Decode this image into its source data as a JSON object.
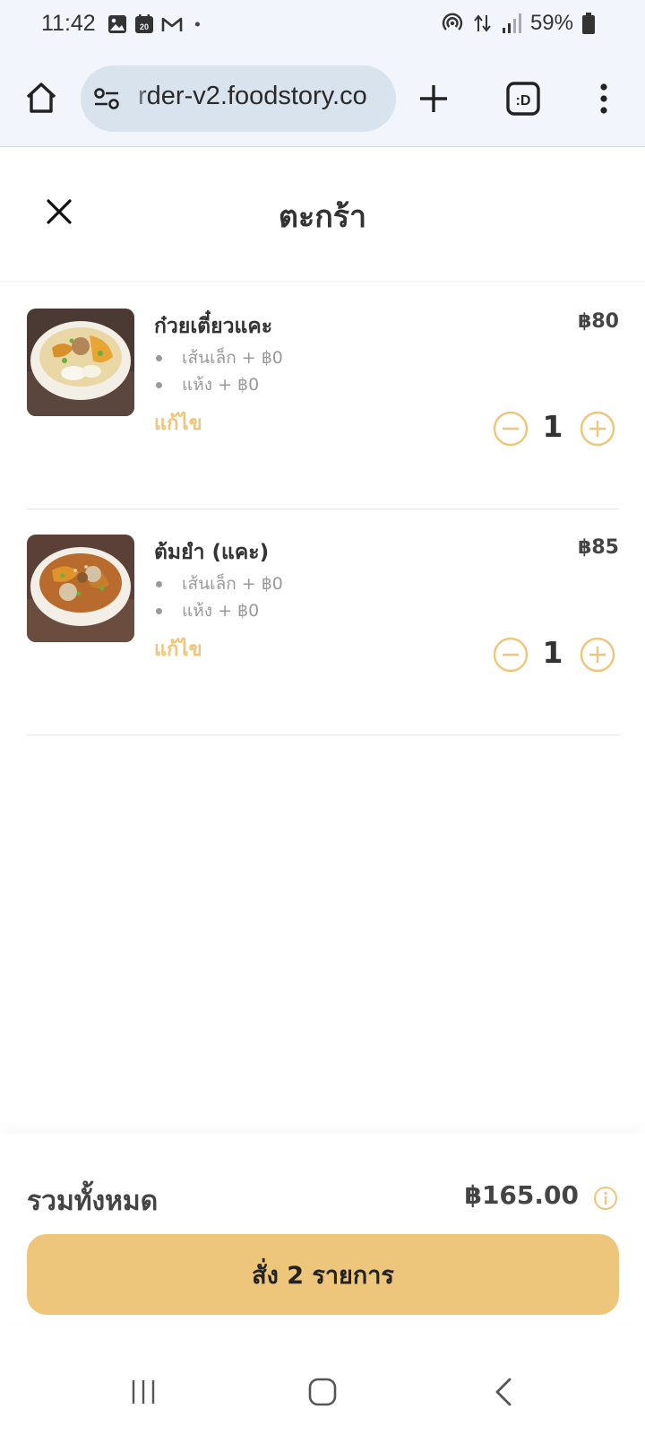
{
  "status_bar": {
    "time": "11:42",
    "calendar_day": "20",
    "battery": "59%",
    "icons": [
      "image-icon",
      "calendar-icon",
      "gmail-icon",
      "notification-dot-icon",
      "hotspot-icon",
      "data-arrows-icon",
      "signal-icon",
      "battery-icon"
    ]
  },
  "browser": {
    "url": "rder-v2.foodstory.co",
    "icons": [
      "home-icon",
      "site-settings-icon",
      "new-tab-icon",
      "tab-switcher-icon",
      "more-menu-icon"
    ],
    "tab_switcher_label": ":D"
  },
  "header": {
    "title": "ตะกร้า"
  },
  "items": [
    {
      "name": "ก๋วยเตี๋ยวแคะ",
      "price": "฿80",
      "options": [
        "เส้นเล็ก + ฿0",
        "แห้ง + ฿0"
      ],
      "edit_label": "แก้ไข",
      "quantity": "1"
    },
    {
      "name": "ต้มยำ (แคะ)",
      "price": "฿85",
      "options": [
        "เส้นเล็ก + ฿0",
        "แห้ง + ฿0"
      ],
      "edit_label": "แก้ไข",
      "quantity": "1"
    }
  ],
  "footer": {
    "total_label": "รวมทั้งหมด",
    "total_amount": "฿165.00",
    "order_button_label": "สั่ง 2 รายการ"
  },
  "nav": {
    "icons": [
      "recent-apps-icon",
      "home-nav-icon",
      "back-icon"
    ]
  },
  "colors": {
    "accent": "#edc67b",
    "browser_bg": "#f2f5fb",
    "url_pill": "#d9e3ee",
    "text_dark": "#333333",
    "text_muted": "#9a9a9a",
    "divider": "#e3e3e3"
  }
}
